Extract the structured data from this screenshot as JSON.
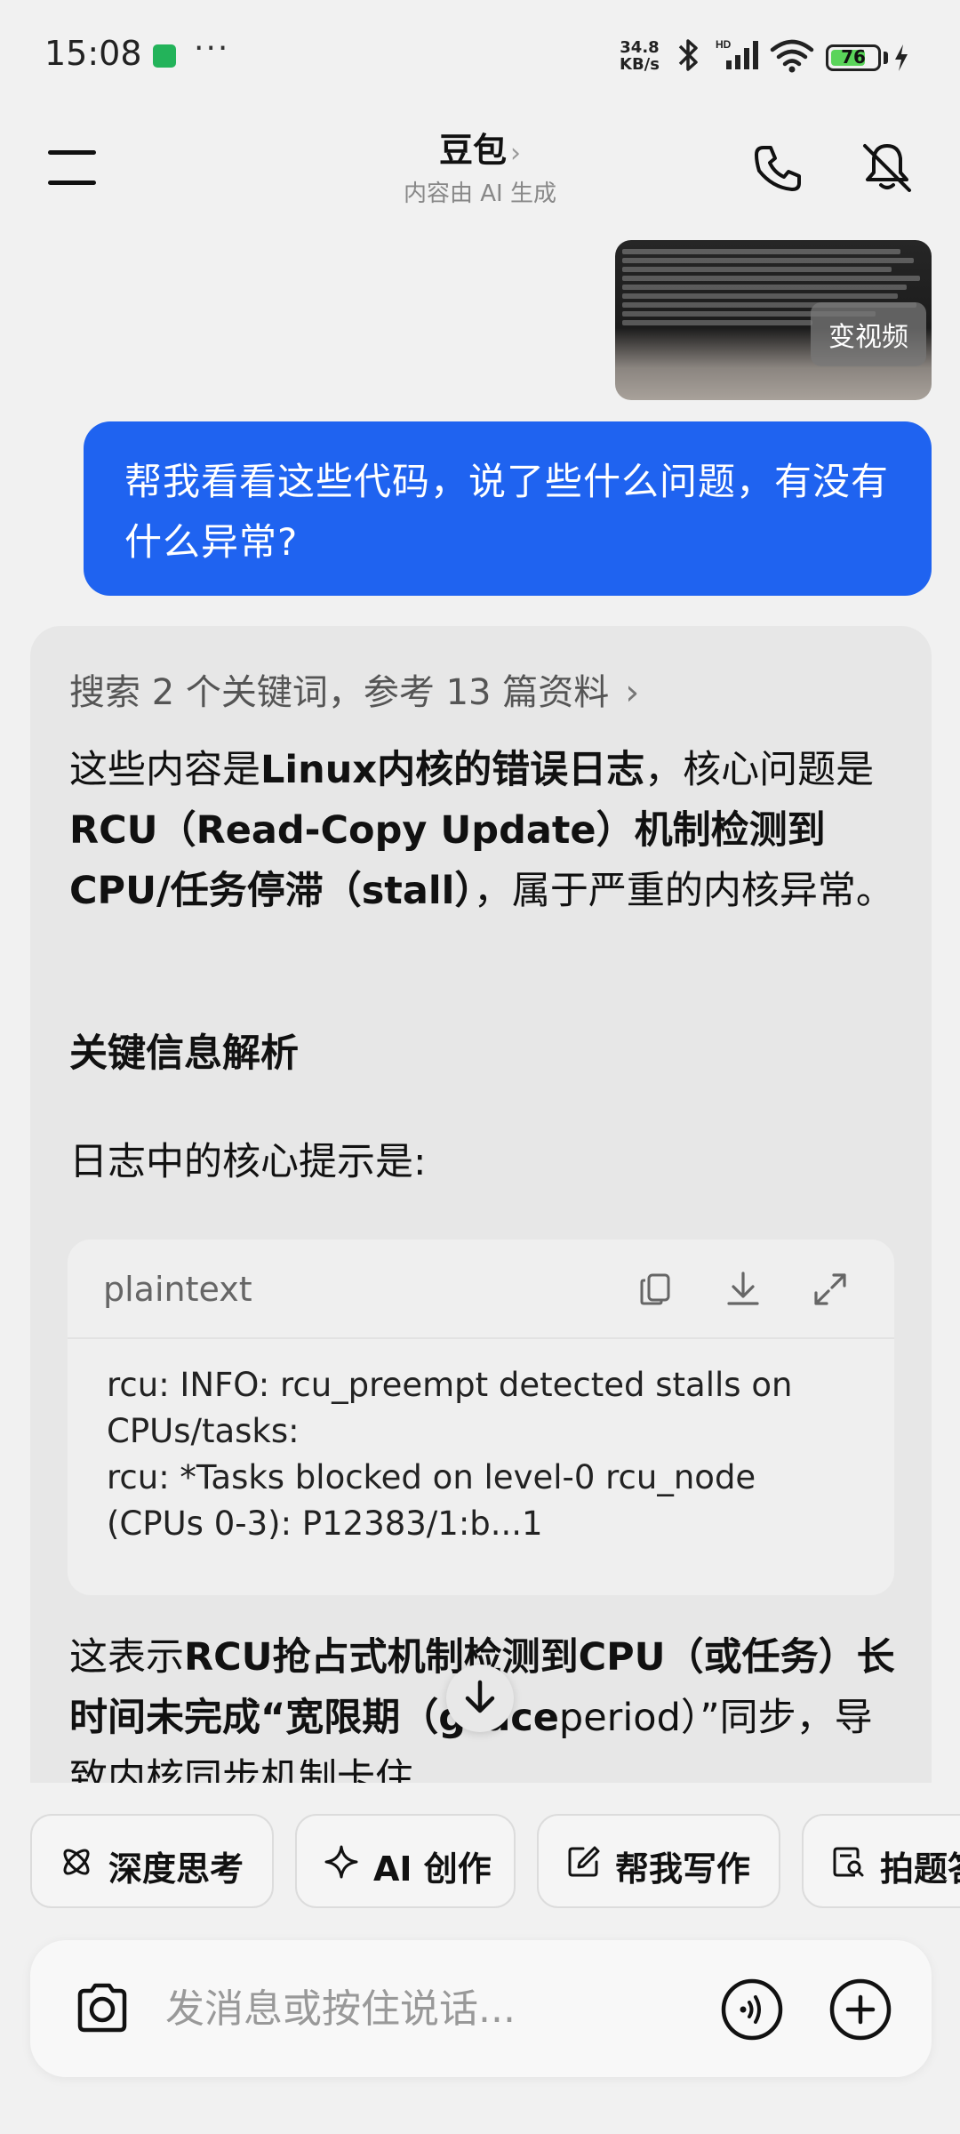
{
  "status_bar": {
    "time": "15:08",
    "dots": "···",
    "net_speed_value": "34.8",
    "net_speed_unit": "KB/s",
    "battery_level": "76",
    "battery_fraction": 0.76
  },
  "header": {
    "title": "豆包",
    "chevron": "›",
    "subtitle": "内容由 AI 生成"
  },
  "chat": {
    "thumbnail_badge": "变视频",
    "user_message": "帮我看看这些代码，说了些什么问题，有没有什么异常?",
    "search_summary": "搜索 2 个关键词，参考 13 篇资料",
    "search_chevron": "›",
    "p1_part1": "这些内容是",
    "p1_bold1": "Linux内核的错误日志",
    "p1_part2": "，核心问题是",
    "p1_bold2": "RCU（Read-Copy Update）机制检测到CPU/任务停滞（stall）",
    "p1_part3": "，属于严重的内核异常。",
    "section_heading": "关键信息解析",
    "intro": "日志中的核心提示是:",
    "code": {
      "language": "plaintext",
      "line1": "rcu: INFO: rcu_preempt detected stalls on",
      "line2": "CPUs/tasks:",
      "line3": "rcu: *Tasks blocked on level-0 rcu_node",
      "line4": "(CPUs 0-3): P12383/1:b...1"
    },
    "p2_part1": "这表示",
    "p2_bold1": "RCU抢占式机制检测到CPU（或任务）长时间未完成“宽限期（grace",
    "p2_tail": "period）”同步，导致内核同步机制卡住"
  },
  "quick_actions": [
    {
      "label": "深度思考",
      "icon": "atom-icon"
    },
    {
      "label": "AI 创作",
      "icon": "sparkle-icon"
    },
    {
      "label": "帮我写作",
      "icon": "edit-icon"
    },
    {
      "label": "拍题答疑",
      "icon": "scan-question-icon"
    }
  ],
  "input": {
    "placeholder": "发消息或按住说话..."
  },
  "colors": {
    "accent": "#1f63f0",
    "background": "#f1f1f1",
    "card": "#e7e7e7"
  }
}
